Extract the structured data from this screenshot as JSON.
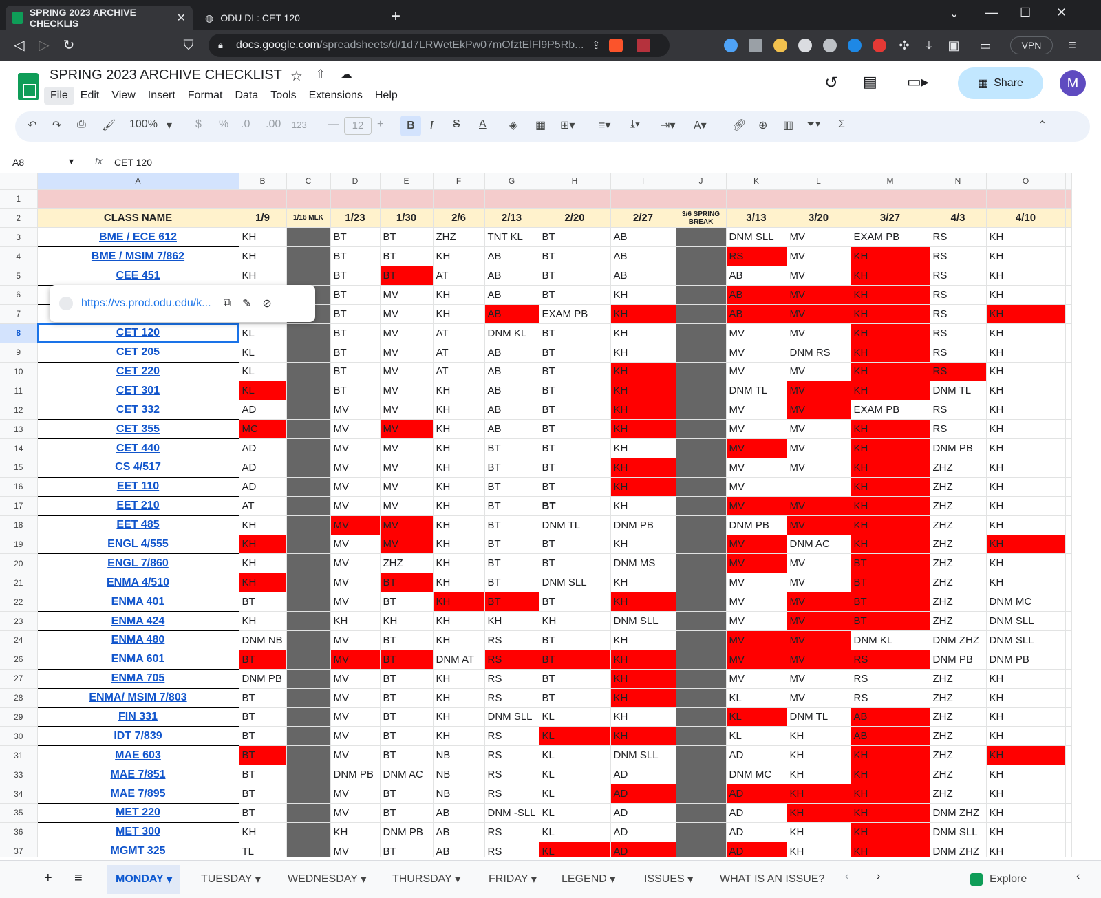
{
  "browser": {
    "tabs": [
      {
        "title": "SPRING 2023 ARCHIVE CHECKLIS",
        "active": true
      },
      {
        "title": "ODU DL: CET 120",
        "active": false
      }
    ],
    "url_host": "docs.google.com",
    "url_path": "/spreadsheets/d/1d7LRWetEkPw07mOfztElFl9P5Rb...",
    "vpn_label": "VPN"
  },
  "doc": {
    "title": "SPRING 2023 ARCHIVE CHECKLIST",
    "menus": [
      "File",
      "Edit",
      "View",
      "Insert",
      "Format",
      "Data",
      "Tools",
      "Extensions",
      "Help"
    ],
    "share_label": "Share",
    "avatar_letter": "M"
  },
  "toolbar": {
    "zoom": "100%",
    "font_size": "12",
    "percent": "%",
    "dollar": "$",
    "dec_down": ".0",
    "dec_up": ".00",
    "num": "123"
  },
  "formula_bar": {
    "cell_ref": "A8",
    "fx": "fx",
    "value": "CET 120"
  },
  "link_popup": {
    "url": "https://vs.prod.odu.edu/k..."
  },
  "grid": {
    "columns": [
      "A",
      "B",
      "C",
      "D",
      "E",
      "F",
      "G",
      "H",
      "I",
      "J",
      "K",
      "L",
      "M",
      "N",
      "O"
    ],
    "header_row": [
      "CLASS NAME",
      "1/9",
      "1/16 MLK",
      "1/23",
      "1/30",
      "2/6",
      "2/13",
      "2/20",
      "2/27",
      "3/6 SPRING BREAK",
      "3/13",
      "3/20",
      "3/27",
      "4/3",
      "4/10"
    ],
    "rows": [
      {
        "n": "3",
        "a": "BME / ECE 612",
        "c": [
          "KH",
          "",
          "BT",
          "BT",
          "ZHZ",
          "TNT KL",
          "BT",
          "AB",
          "",
          "DNM SLL",
          "MV",
          "EXAM PB",
          "RS",
          "KH"
        ],
        "red": []
      },
      {
        "n": "4",
        "a": "BME / MSIM 7/862",
        "c": [
          "KH",
          "",
          "BT",
          "BT",
          "KH",
          "AB",
          "BT",
          "AB",
          "",
          "RS",
          "MV",
          "KH",
          "RS",
          "KH"
        ],
        "red": [
          9,
          11
        ]
      },
      {
        "n": "5",
        "a": "CEE 451",
        "c": [
          "KH",
          "",
          "BT",
          "BT",
          "AT",
          "AB",
          "BT",
          "AB",
          "",
          "AB",
          "MV",
          "KH",
          "RS",
          "KH"
        ],
        "red": [
          3,
          11
        ]
      },
      {
        "n": "6",
        "a": "",
        "c": [
          "",
          "",
          "BT",
          "MV",
          "KH",
          "AB",
          "BT",
          "KH",
          "",
          "AB",
          "MV",
          "KH",
          "RS",
          "KH"
        ],
        "red": [
          9,
          10,
          11
        ]
      },
      {
        "n": "7",
        "a": "",
        "c": [
          "",
          "",
          "BT",
          "MV",
          "KH",
          "AB",
          "EXAM PB",
          "KH",
          "",
          "AB",
          "MV",
          "KH",
          "RS",
          "KH"
        ],
        "red": [
          5,
          7,
          9,
          10,
          11,
          13
        ]
      },
      {
        "n": "8",
        "a": "CET 120",
        "c": [
          "KL",
          "",
          "BT",
          "MV",
          "AT",
          "DNM KL",
          "BT",
          "KH",
          "",
          "MV",
          "MV",
          "KH",
          "RS",
          "KH"
        ],
        "red": [
          11
        ]
      },
      {
        "n": "9",
        "a": "CET 205",
        "c": [
          "KL",
          "",
          "BT",
          "MV",
          "AT",
          "AB",
          "BT",
          "KH",
          "",
          "MV",
          "DNM RS",
          "KH",
          "RS",
          "KH"
        ],
        "red": [
          11
        ]
      },
      {
        "n": "10",
        "a": "CET 220",
        "c": [
          "KL",
          "",
          "BT",
          "MV",
          "AT",
          "AB",
          "BT",
          "KH",
          "",
          "MV",
          "MV",
          "KH",
          "RS",
          "KH"
        ],
        "red": [
          7,
          11,
          12
        ]
      },
      {
        "n": "11",
        "a": "CET 301",
        "c": [
          "KL",
          "",
          "BT",
          "MV",
          "KH",
          "AB",
          "BT",
          "KH",
          "",
          "DNM TL",
          "MV",
          "KH",
          "DNM TL",
          "KH"
        ],
        "red": [
          0,
          7,
          10,
          11
        ]
      },
      {
        "n": "12",
        "a": "CET 332",
        "c": [
          "AD",
          "",
          "MV",
          "MV",
          "KH",
          "AB",
          "BT",
          "KH",
          "",
          "MV",
          "MV",
          "EXAM PB",
          "RS",
          "KH"
        ],
        "red": [
          7,
          10
        ]
      },
      {
        "n": "13",
        "a": "CET 355",
        "c": [
          "MC",
          "",
          "MV",
          "MV",
          "KH",
          "AB",
          "BT",
          "KH",
          "",
          "MV",
          "MV",
          "KH",
          "RS",
          "KH"
        ],
        "red": [
          0,
          3,
          7,
          11
        ]
      },
      {
        "n": "14",
        "a": "CET 440",
        "c": [
          "AD",
          "",
          "MV",
          "MV",
          "KH",
          "BT",
          "BT",
          "KH",
          "",
          "MV",
          "MV",
          "KH",
          "DNM PB",
          "KH"
        ],
        "red": [
          9,
          11
        ]
      },
      {
        "n": "15",
        "a": "CS 4/517",
        "c": [
          "AD",
          "",
          "MV",
          "MV",
          "KH",
          "BT",
          "BT",
          "KH",
          "",
          "MV",
          "MV",
          "KH",
          "ZHZ",
          "KH"
        ],
        "red": [
          7,
          11
        ]
      },
      {
        "n": "16",
        "a": "EET 110",
        "c": [
          "AD",
          "",
          "MV",
          "MV",
          "KH",
          "BT",
          "BT",
          "KH",
          "",
          "MV",
          "",
          "KH",
          "ZHZ",
          "KH"
        ],
        "red": [
          7,
          11
        ]
      },
      {
        "n": "17",
        "a": "EET 210",
        "c": [
          "AT",
          "",
          "MV",
          "MV",
          "KH",
          "BT",
          "BT",
          "KH",
          "",
          "MV",
          "MV",
          "KH",
          "ZHZ",
          "KH"
        ],
        "red": [
          9,
          10,
          11
        ]
      },
      {
        "n": "18",
        "a": "EET 485",
        "c": [
          "KH",
          "",
          "MV",
          "MV",
          "KH",
          "BT",
          "DNM TL",
          "DNM PB",
          "",
          "DNM PB",
          "MV",
          "KH",
          "ZHZ",
          "KH"
        ],
        "red": [
          2,
          3,
          10,
          11
        ]
      },
      {
        "n": "19",
        "a": "ENGL 4/555",
        "c": [
          "KH",
          "",
          "MV",
          "MV",
          "KH",
          "BT",
          "BT",
          "KH",
          "",
          "MV",
          "DNM AC",
          "KH",
          "ZHZ",
          "KH"
        ],
        "red": [
          0,
          3,
          9,
          11,
          13
        ]
      },
      {
        "n": "20",
        "a": "ENGL 7/860",
        "c": [
          "KH",
          "",
          "MV",
          "ZHZ",
          "KH",
          "BT",
          "BT",
          "DNM MS",
          "",
          "MV",
          "MV",
          "BT",
          "ZHZ",
          "KH"
        ],
        "red": [
          9,
          11
        ]
      },
      {
        "n": "21",
        "a": "ENMA 4/510",
        "c": [
          "KH",
          "",
          "MV",
          "BT",
          "KH",
          "BT",
          "DNM SLL",
          "KH",
          "",
          "MV",
          "MV",
          "BT",
          "ZHZ",
          "KH"
        ],
        "red": [
          0,
          3,
          11
        ]
      },
      {
        "n": "22",
        "a": "ENMA 401",
        "c": [
          "BT",
          "",
          "MV",
          "BT",
          "KH",
          "BT",
          "BT",
          "KH",
          "",
          "MV",
          "MV",
          "BT",
          "ZHZ",
          "DNM MC"
        ],
        "red": [
          4,
          5,
          7,
          10,
          11
        ]
      },
      {
        "n": "23",
        "a": "ENMA 424",
        "c": [
          "KH",
          "",
          "KH",
          "KH",
          "KH",
          "KH",
          "KH",
          "DNM SLL",
          "",
          "MV",
          "MV",
          "BT",
          "ZHZ",
          "DNM SLL"
        ],
        "red": [
          10,
          11
        ]
      },
      {
        "n": "24",
        "a": "ENMA 480",
        "c": [
          "DNM NB",
          "",
          "MV",
          "BT",
          "KH",
          "RS",
          "BT",
          "KH",
          "",
          "MV",
          "MV",
          "DNM KL",
          "DNM ZHZ",
          "DNM SLL"
        ],
        "red": [
          9,
          10
        ]
      },
      {
        "n": "26",
        "a": "ENMA 601",
        "c": [
          "BT",
          "",
          "MV",
          "BT",
          "DNM AT",
          "RS",
          "BT",
          "KH",
          "",
          "MV",
          "MV",
          "RS",
          "DNM PB",
          "DNM PB"
        ],
        "red": [
          0,
          2,
          3,
          5,
          6,
          7,
          9,
          10,
          11
        ]
      },
      {
        "n": "27",
        "a": "ENMA 705",
        "c": [
          "DNM PB",
          "",
          "MV",
          "BT",
          "KH",
          "RS",
          "BT",
          "KH",
          "",
          "MV",
          "MV",
          "RS",
          "ZHZ",
          "KH"
        ],
        "red": [
          7
        ]
      },
      {
        "n": "28",
        "a": "ENMA/ MSIM 7/803",
        "c": [
          "BT",
          "",
          "MV",
          "BT",
          "KH",
          "RS",
          "BT",
          "KH",
          "",
          "KL",
          "MV",
          "RS",
          "ZHZ",
          "KH"
        ],
        "red": [
          7
        ]
      },
      {
        "n": "29",
        "a": "FIN 331",
        "c": [
          "BT",
          "",
          "MV",
          "BT",
          "KH",
          "DNM SLL",
          "KL",
          "KH",
          "",
          "KL",
          "DNM TL",
          "AB",
          "ZHZ",
          "KH"
        ],
        "red": [
          9,
          11
        ]
      },
      {
        "n": "30",
        "a": "IDT 7/839",
        "c": [
          "BT",
          "",
          "MV",
          "BT",
          "KH",
          "RS",
          "KL",
          "KH",
          "",
          "KL",
          "KH",
          "AB",
          "ZHZ",
          "KH"
        ],
        "red": [
          6,
          7,
          11
        ]
      },
      {
        "n": "31",
        "a": "MAE 603",
        "c": [
          "BT",
          "",
          "MV",
          "BT",
          "NB",
          "RS",
          "KL",
          "DNM SLL",
          "",
          "AD",
          "KH",
          "KH",
          "ZHZ",
          "KH"
        ],
        "red": [
          0,
          11,
          13
        ]
      },
      {
        "n": "33",
        "a": "MAE 7/851",
        "c": [
          "BT",
          "",
          "DNM PB",
          "DNM AC",
          "NB",
          "RS",
          "KL",
          "AD",
          "",
          "DNM MC",
          "KH",
          "KH",
          "ZHZ",
          "KH"
        ],
        "red": [
          11
        ]
      },
      {
        "n": "34",
        "a": "MAE 7/895",
        "c": [
          "BT",
          "",
          "MV",
          "BT",
          "NB",
          "RS",
          "KL",
          "AD",
          "",
          "AD",
          "KH",
          "KH",
          "ZHZ",
          "KH"
        ],
        "red": [
          7,
          9,
          10,
          11
        ]
      },
      {
        "n": "35",
        "a": "MET 220",
        "c": [
          "BT",
          "",
          "MV",
          "BT",
          "AB",
          "DNM -SLL",
          "KL",
          "AD",
          "",
          "AD",
          "KH",
          "KH",
          "DNM ZHZ",
          "KH"
        ],
        "red": [
          10,
          11
        ]
      },
      {
        "n": "36",
        "a": "MET 300",
        "c": [
          "KH",
          "",
          "KH",
          "DNM PB",
          "AB",
          "RS",
          "KL",
          "AD",
          "",
          "AD",
          "KH",
          "KH",
          "DNM SLL",
          "KH"
        ],
        "red": [
          11
        ]
      },
      {
        "n": "37",
        "a": "MGMT 325",
        "c": [
          "TL",
          "",
          "MV",
          "BT",
          "AB",
          "RS",
          "KL",
          "AD",
          "",
          "AD",
          "KH",
          "KH",
          "DNM ZHZ",
          "KH"
        ],
        "red": [
          6,
          7,
          9,
          11
        ]
      }
    ]
  },
  "sheet_tabs": [
    "MONDAY",
    "TUESDAY",
    "WEDNESDAY",
    "THURSDAY",
    "FRIDAY",
    "LEGEND",
    "ISSUES",
    "WHAT IS AN ISSUE?"
  ],
  "explore_label": "Explore"
}
